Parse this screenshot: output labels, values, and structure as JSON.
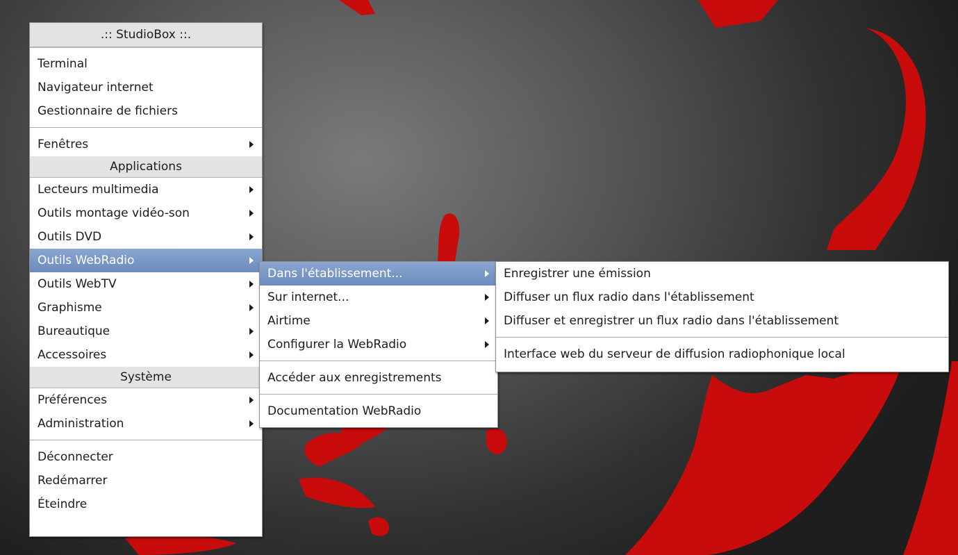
{
  "main_menu": {
    "title": ".:: StudioBox ::.",
    "section_top": [
      "Terminal",
      "Navigateur internet",
      "Gestionnaire de fichiers"
    ],
    "windows_label": "Fenêtres",
    "applications_header": "Applications",
    "applications": [
      {
        "label": "Lecteurs multimedia",
        "submenu": true
      },
      {
        "label": "Outils montage vidéo-son",
        "submenu": true
      },
      {
        "label": "Outils DVD",
        "submenu": true
      },
      {
        "label": "Outils WebRadio",
        "submenu": true,
        "active": true
      },
      {
        "label": "Outils WebTV",
        "submenu": true
      },
      {
        "label": "Graphisme",
        "submenu": true
      },
      {
        "label": "Bureautique",
        "submenu": true
      },
      {
        "label": "Accessoires",
        "submenu": true
      }
    ],
    "system_header": "Système",
    "system": [
      {
        "label": "Préférences",
        "submenu": true
      },
      {
        "label": "Administration",
        "submenu": true
      }
    ],
    "session": [
      "Déconnecter",
      "Redémarrer",
      "Éteindre"
    ]
  },
  "webradio_menu": {
    "items": [
      {
        "label": "Dans l'établissement...",
        "submenu": true,
        "active": true
      },
      {
        "label": "Sur internet...",
        "submenu": true
      },
      {
        "label": "Airtime",
        "submenu": true
      },
      {
        "label": "Configurer la WebRadio",
        "submenu": true
      }
    ],
    "recordings": "Accéder aux enregistrements",
    "documentation": "Documentation WebRadio"
  },
  "dans_menu": {
    "items": [
      "Enregistrer une émission",
      "Diffuser un flux radio dans l'établissement",
      "Diffuser et enregistrer un flux radio dans l'établissement"
    ],
    "web_interface": "Interface web du serveur de diffusion radiophonique local"
  },
  "colors": {
    "highlight": "#7895c4",
    "wallpaper_red": "#c80b0b",
    "menu_header_bg": "#e3e3e3"
  }
}
